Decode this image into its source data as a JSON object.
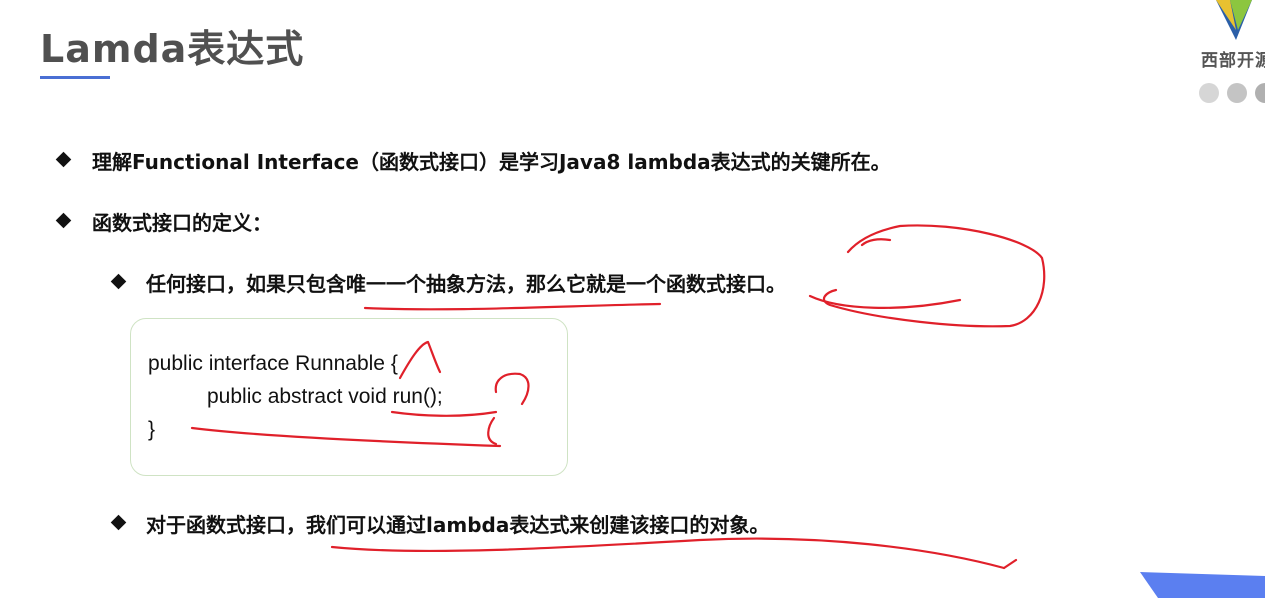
{
  "slide": {
    "title": "Lamda表达式",
    "logo_text": "西部开源",
    "bullets": [
      "理解Functional Interface（函数式接口）是学习Java8 lambda表达式的关键所在。",
      "函数式接口的定义：",
      "任何接口，如果只包含唯一一个抽象方法，那么它就是一个函数式接口。",
      "对于函数式接口，我们可以通过lambda表达式来创建该接口的对象。"
    ],
    "code_lines": [
      "public interface Runnable {",
      "public abstract void run();",
      "}"
    ]
  },
  "colors": {
    "accent": "#4a6fd4",
    "ink": "#e0202a",
    "title": "#505050",
    "code_border": "#cfe3c4"
  },
  "icons": {
    "logo": "v-shape-logo",
    "bullet": "diamond-bullet",
    "dots": "slide-dots-icon"
  }
}
